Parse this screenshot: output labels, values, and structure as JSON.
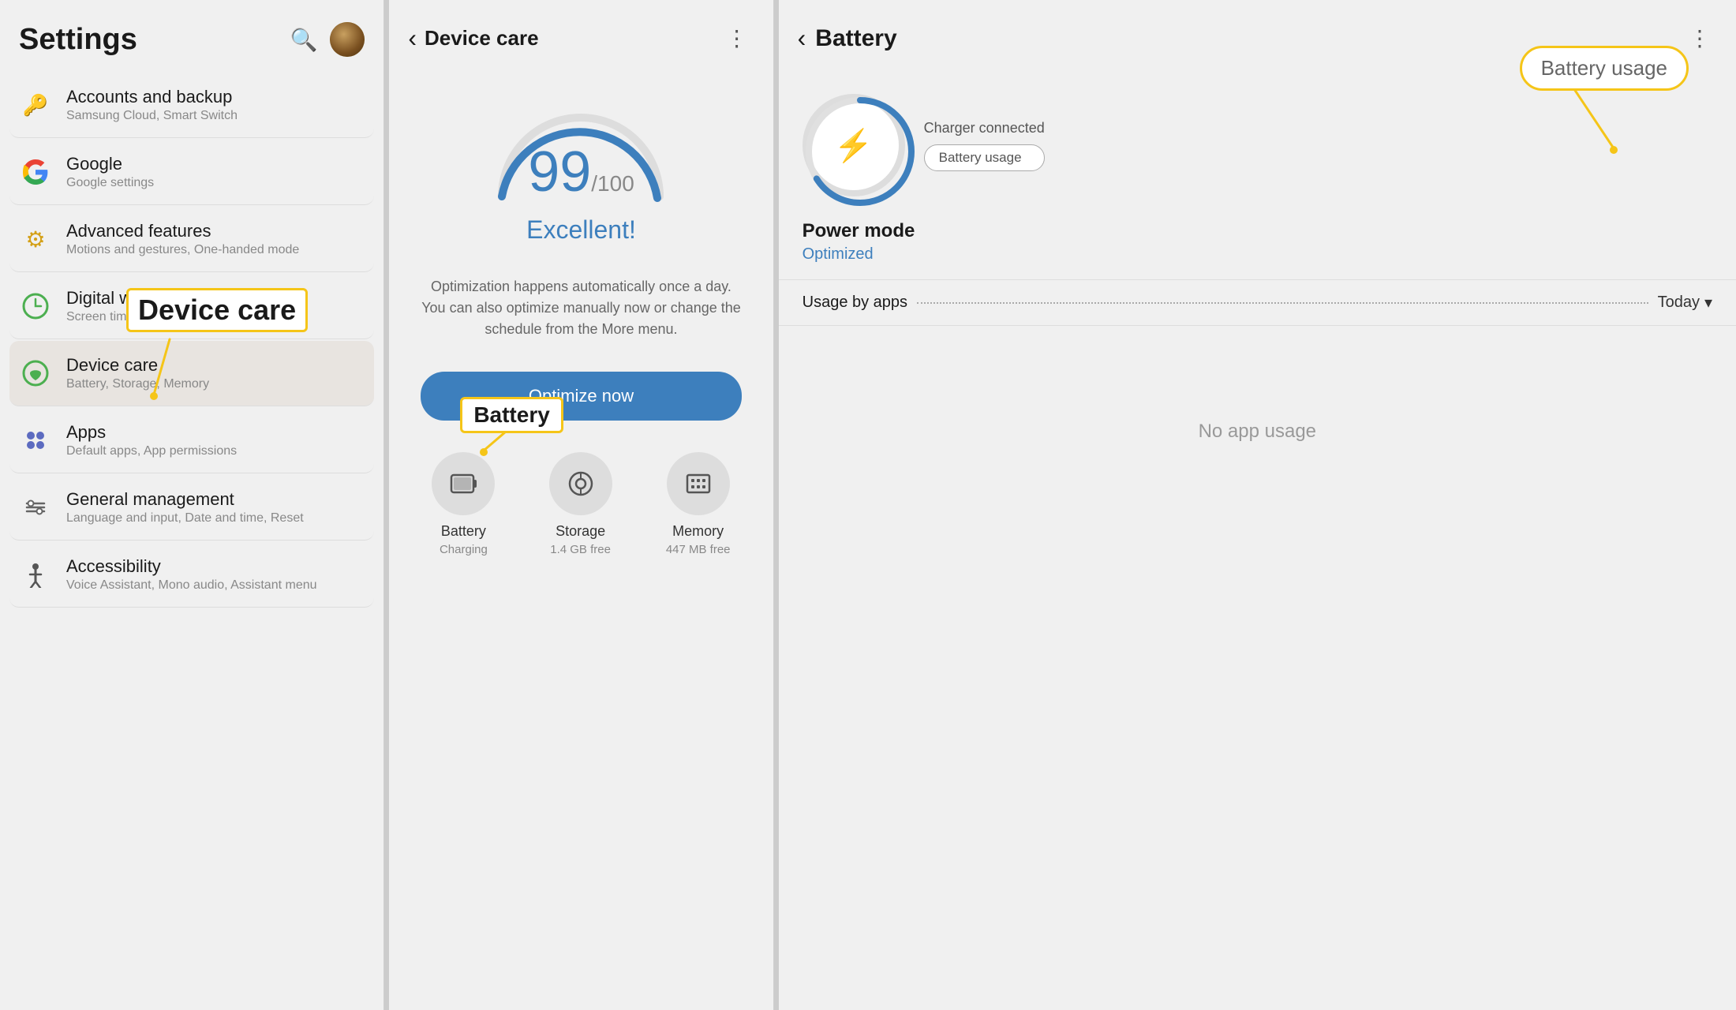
{
  "leftPanel": {
    "title": "Settings",
    "items": [
      {
        "icon": "🔑",
        "iconColor": "#d4a017",
        "title": "Accounts and backup",
        "subtitle": "Samsung Cloud, Smart Switch"
      },
      {
        "icon": "G",
        "iconColor": "#4285F4",
        "title": "Google",
        "subtitle": "Google settings",
        "isGoogle": true
      },
      {
        "icon": "⚙",
        "iconColor": "#d4a017",
        "title": "Advanced features",
        "subtitle": "Motions and gestures, One-handed mode"
      },
      {
        "icon": "🕐",
        "iconColor": "#4CAF50",
        "title": "Digital wellbeing and parental controls",
        "subtitle": "Screen time, App timers, Wind down",
        "truncated": "Digital we..."
      },
      {
        "icon": "♻",
        "iconColor": "#4CAF50",
        "title": "Device care",
        "subtitle": "Battery, Storage, Memory",
        "highlighted": true
      },
      {
        "icon": "⬛",
        "iconColor": "#5c6bc0",
        "title": "Apps",
        "subtitle": "Default apps, App permissions"
      },
      {
        "icon": "⚖",
        "iconColor": "#666",
        "title": "General management",
        "subtitle": "Language and input, Date and time, Reset"
      },
      {
        "icon": "♿",
        "iconColor": "#555",
        "title": "Accessibility",
        "subtitle": "Voice Assistant, Mono audio, Assistant menu"
      }
    ],
    "annotation": {
      "text": "Device care"
    }
  },
  "middlePanel": {
    "title": "Device care",
    "score": "99",
    "scoreMax": "/100",
    "scoreLabel": "Excellent!",
    "description": "Optimization happens automatically once a day. You can also optimize manually now or change the schedule from the More menu.",
    "optimizeButton": "Optimize now",
    "bottomIcons": [
      {
        "icon": "🔋",
        "label": "Battery",
        "sublabel": "Charging",
        "annotated": true
      },
      {
        "icon": "💾",
        "label": "Storage",
        "sublabel": "1.4 GB free"
      },
      {
        "icon": "⬛",
        "label": "Memory",
        "sublabel": "447 MB free"
      }
    ],
    "annotation": {
      "text": "Battery"
    }
  },
  "rightPanel": {
    "title": "Battery",
    "chargerStatus": "Charger connected",
    "batteryUsageButton": "Battery usage",
    "batteryUsageAnnotation": "Battery usage",
    "powerMode": {
      "label": "Power mode",
      "value": "Optimized"
    },
    "usageByApps": {
      "label": "Usage by apps",
      "period": "Today"
    },
    "noAppUsage": "No app usage"
  },
  "icons": {
    "back": "‹",
    "search": "🔍",
    "threeDot": "⋮",
    "chevronDown": "▾",
    "lightning": "⚡"
  }
}
